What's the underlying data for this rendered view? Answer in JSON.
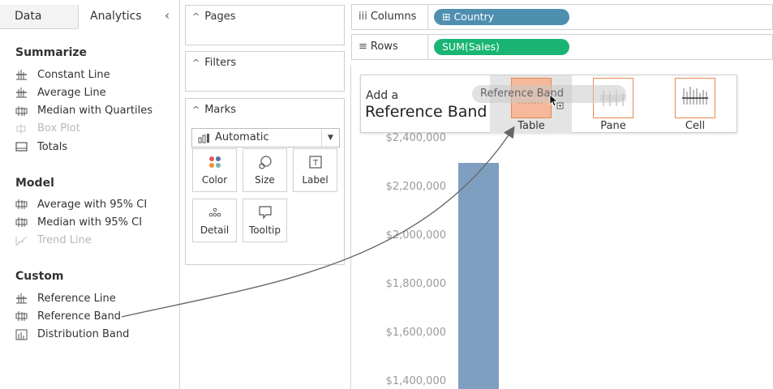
{
  "tabs": {
    "data_label": "Data",
    "analytics_label": "Analytics",
    "collapse_glyph": "‹"
  },
  "summarize": {
    "title": "Summarize",
    "items": [
      {
        "label": "Constant Line",
        "icon": "constant-line-icon",
        "enabled": true
      },
      {
        "label": "Average Line",
        "icon": "average-line-icon",
        "enabled": true
      },
      {
        "label": "Median with Quartiles",
        "icon": "median-quartiles-icon",
        "enabled": true
      },
      {
        "label": "Box Plot",
        "icon": "box-plot-icon",
        "enabled": false
      },
      {
        "label": "Totals",
        "icon": "totals-icon",
        "enabled": true
      }
    ]
  },
  "model": {
    "title": "Model",
    "items": [
      {
        "label": "Average with 95% CI",
        "icon": "average-ci-icon",
        "enabled": true
      },
      {
        "label": "Median with 95% CI",
        "icon": "median-ci-icon",
        "enabled": true
      },
      {
        "label": "Trend Line",
        "icon": "trend-line-icon",
        "enabled": false
      }
    ]
  },
  "custom": {
    "title": "Custom",
    "items": [
      {
        "label": "Reference Line",
        "icon": "reference-line-icon",
        "enabled": true
      },
      {
        "label": "Reference Band",
        "icon": "reference-band-icon",
        "enabled": true
      },
      {
        "label": "Distribution Band",
        "icon": "distribution-band-icon",
        "enabled": true
      }
    ]
  },
  "cards": {
    "pages_title": "Pages",
    "filters_title": "Filters",
    "marks_title": "Marks",
    "marks_type": "Automatic",
    "mark_buttons": [
      {
        "label": "Color",
        "icon": "color-icon"
      },
      {
        "label": "Size",
        "icon": "size-icon"
      },
      {
        "label": "Label",
        "icon": "label-icon"
      },
      {
        "label": "Detail",
        "icon": "detail-icon"
      },
      {
        "label": "Tooltip",
        "icon": "tooltip-icon"
      }
    ]
  },
  "shelves": {
    "columns_label": "Columns",
    "columns_pill": "⊞ Country",
    "columns_pill_color": "#4e8fb0",
    "rows_label": "Rows",
    "rows_pill": "SUM(Sales)",
    "rows_pill_color": "#1ab574"
  },
  "popup": {
    "add_a": "Add a",
    "title": "Reference Band",
    "drag_chip": "Reference Band",
    "options": [
      {
        "label": "Table",
        "selected": true
      },
      {
        "label": "Pane",
        "selected": false
      },
      {
        "label": "Cell",
        "selected": false
      }
    ],
    "highlight_color": "#f6b89a",
    "accent_color": "#e8894f"
  },
  "chart_data": {
    "type": "bar",
    "tick_labels": [
      "$2,400,000",
      "$2,200,000",
      "$2,000,000",
      "$1,800,000",
      "$1,600,000",
      "$1,400,000"
    ],
    "ticks": [
      2400000,
      2200000,
      2000000,
      1800000,
      1600000,
      1400000
    ],
    "values": [
      2300000
    ],
    "bar_color": "#7f9fc0"
  }
}
